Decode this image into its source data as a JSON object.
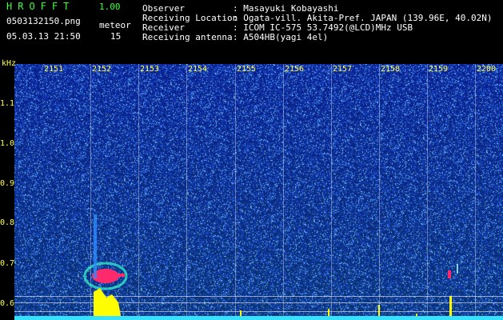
{
  "header": {
    "logo": "HROFFT",
    "version": "1.00",
    "filename": "0503132150.png",
    "meteor_label": "meteor",
    "datetime": "05.03.13 21:50",
    "meteor_count": "15"
  },
  "info": {
    "observer_label": "Observer",
    "observer_value": ": Masayuki Kobayashi",
    "location_label": "Receiving Location",
    "location_value": ": Ogata-vill. Akita-Pref. JAPAN (139.96E, 40.02N)",
    "receiver_label": "Receiver",
    "receiver_value": ": ICOM IC-575 53.7492(@LCD)MHz USB",
    "antenna_label": "Receiving antenna",
    "antenna_value": ": A504HB(yagi 4el)"
  },
  "spectrogram": {
    "y_unit": "kHz",
    "y_ticks": [
      "1.1",
      "1.0",
      "0.9",
      "0.8",
      "0.7",
      "0.6"
    ],
    "x_ticks": [
      "2151",
      "2152",
      "2153",
      "2154",
      "2155",
      "2156",
      "2157",
      "2158",
      "2159",
      "2200"
    ],
    "background_color": "#0a1f8a",
    "event_color": "#ff2a6e",
    "burst_color": "#ffff00",
    "baseline_color": "#36e0ff"
  }
}
